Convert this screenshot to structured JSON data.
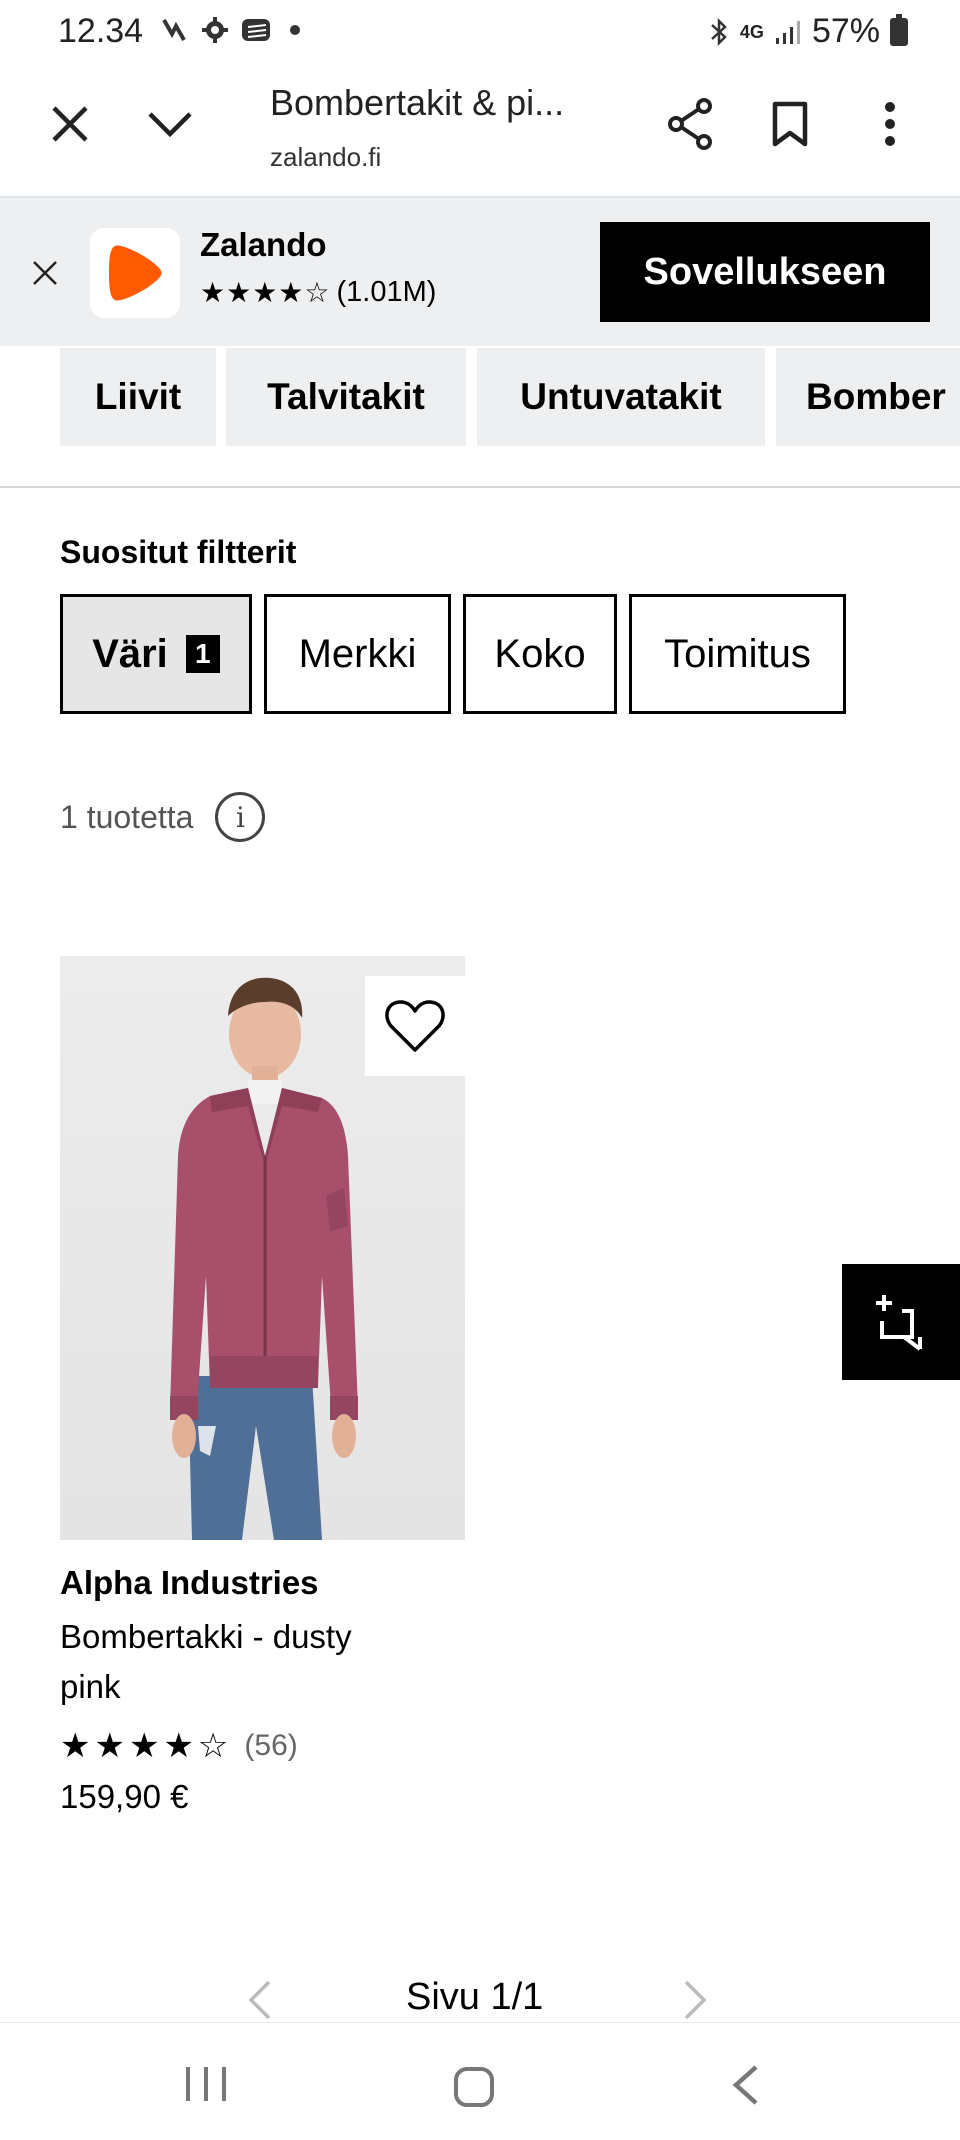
{
  "status_bar": {
    "time": "12.34",
    "network": "4G",
    "battery": "57%"
  },
  "browser": {
    "title": "Bombertakit & pi...",
    "url": "zalando.fi"
  },
  "app_banner": {
    "name": "Zalando",
    "stars": "★★★★☆",
    "rating_count": "(1.01M)",
    "open_button": "Sovellukseen",
    "brand_color": "#ff5a00"
  },
  "categories": [
    "Liivit",
    "Talvitakit",
    "Untuvatakit",
    "Bomber"
  ],
  "filters": {
    "heading": "Suositut filtterit",
    "items": [
      {
        "label": "Väri",
        "count": "1",
        "active": true
      },
      {
        "label": "Merkki"
      },
      {
        "label": "Koko"
      },
      {
        "label": "Toimitus"
      }
    ]
  },
  "results": {
    "count_label": "1 tuotetta"
  },
  "product": {
    "brand": "Alpha Industries",
    "name": "Bombertakki - dusty pink",
    "stars": "★★★★☆",
    "rating": 4.5,
    "review_count": "(56)",
    "price": "159,90 €",
    "jacket_color": "#a8506b"
  },
  "pagination": {
    "label": "Sivu 1/1"
  }
}
